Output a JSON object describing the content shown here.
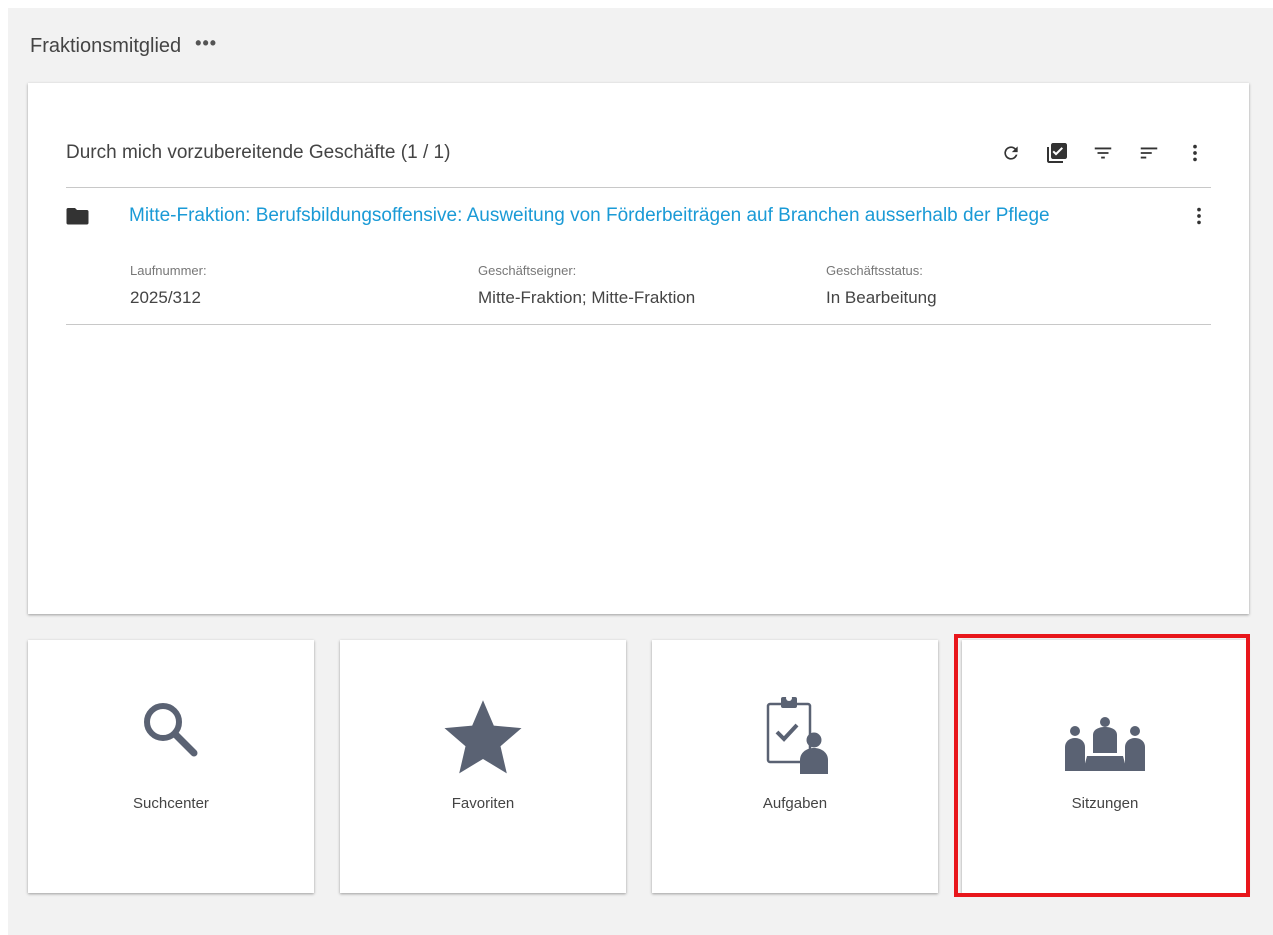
{
  "header": {
    "title": "Fraktionsmitglied",
    "more_label": "•••"
  },
  "widget": {
    "title": "Durch mich vorzubereitende Geschäfte (1 / 1)",
    "toolbar_icons": [
      "refresh-icon",
      "select-all-icon",
      "filter-icon",
      "sort-icon",
      "more-vert-icon"
    ],
    "items": [
      {
        "title": "Mitte-Fraktion: Berufsbildungsoffensive: Ausweitung von Förderbeiträgen auf Branchen ausserhalb der Pflege",
        "fields": [
          {
            "label": "Laufnummer:",
            "value": "2025/312"
          },
          {
            "label": "Geschäftseigner:",
            "value": "Mitte-Fraktion; Mitte-Fraktion"
          },
          {
            "label": "Geschäftsstatus:",
            "value": "In Bearbeitung"
          }
        ]
      }
    ]
  },
  "tiles": [
    {
      "label": "Suchcenter",
      "icon": "search-icon"
    },
    {
      "label": "Favoriten",
      "icon": "star-icon"
    },
    {
      "label": "Aufgaben",
      "icon": "tasks-icon"
    },
    {
      "label": "Sitzungen",
      "icon": "meeting-icon"
    }
  ],
  "colors": {
    "accent_link": "#1a9ad6",
    "icon": "#5a6273",
    "highlight": "#e8161b"
  }
}
